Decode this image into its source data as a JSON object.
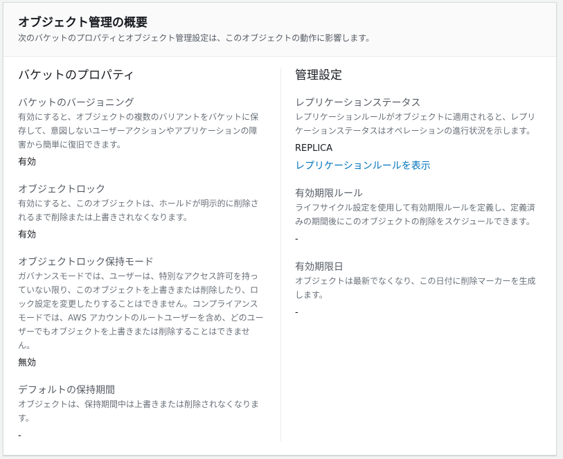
{
  "header": {
    "title": "オブジェクト管理の概要",
    "description": "次のバケットのプロパティとオブジェクト管理設定は、このオブジェクトの動作に影響します。"
  },
  "bucket_properties": {
    "heading": "バケットのプロパティ",
    "versioning": {
      "label": "バケットのバージョニング",
      "desc_lines": [
        "有効にすると、オブジェクトの複数のバリアントをバケットに保",
        "存して、意図しないユーザーアクションやアプリケーションの障",
        "害から簡単に復旧できます。"
      ],
      "value": "有効"
    },
    "object_lock": {
      "label": "オブジェクトロック",
      "desc_lines": [
        "有効にすると、このオブジェクトは、ホールドが明示的に削除さ",
        "れるまで削除または上書きされなくなります。"
      ],
      "value": "有効"
    },
    "retention_mode": {
      "label": "オブジェクトロック保持モード",
      "desc_lines": [
        "ガバナンスモードでは、ユーザーは、特別なアクセス許可を持っ",
        "ていない限り、このオブジェクトを上書きまたは削除したり、ロ",
        "ック設定を変更したりすることはできません。コンプライアンス",
        "モードでは、AWS アカウントのルートユーザーを含め、どのユー",
        "ザーでもオブジェクトを上書きまたは削除することはできませ",
        "ん。"
      ],
      "value": "無効"
    },
    "default_retention": {
      "label": "デフォルトの保持期間",
      "desc_lines": [
        "オブジェクトは、保持期間中は上書きまたは削除されなくなりま",
        "す。"
      ],
      "value": "-"
    }
  },
  "management": {
    "heading": "管理設定",
    "replication": {
      "label": "レプリケーションステータス",
      "desc_lines": [
        "レプリケーションルールがオブジェクトに適用されると、レプリ",
        "ケーションステータスはオペレーションの進行状況を示します。"
      ],
      "value": "REPLICA",
      "link": "レプリケーションルールを表示"
    },
    "expiration_rule": {
      "label": "有効期限ルール",
      "desc_lines": [
        "ライフサイクル設定を使用して有効期限ルールを定義し、定義済",
        "みの期間後にこのオブジェクトの削除をスケジュールできます。"
      ],
      "value": "-"
    },
    "expiration_date": {
      "label": "有効期限日",
      "desc_lines": [
        "オブジェクトは最新でなくなり、この日付に削除マーカーを生成",
        "します。"
      ],
      "value": "-"
    }
  }
}
